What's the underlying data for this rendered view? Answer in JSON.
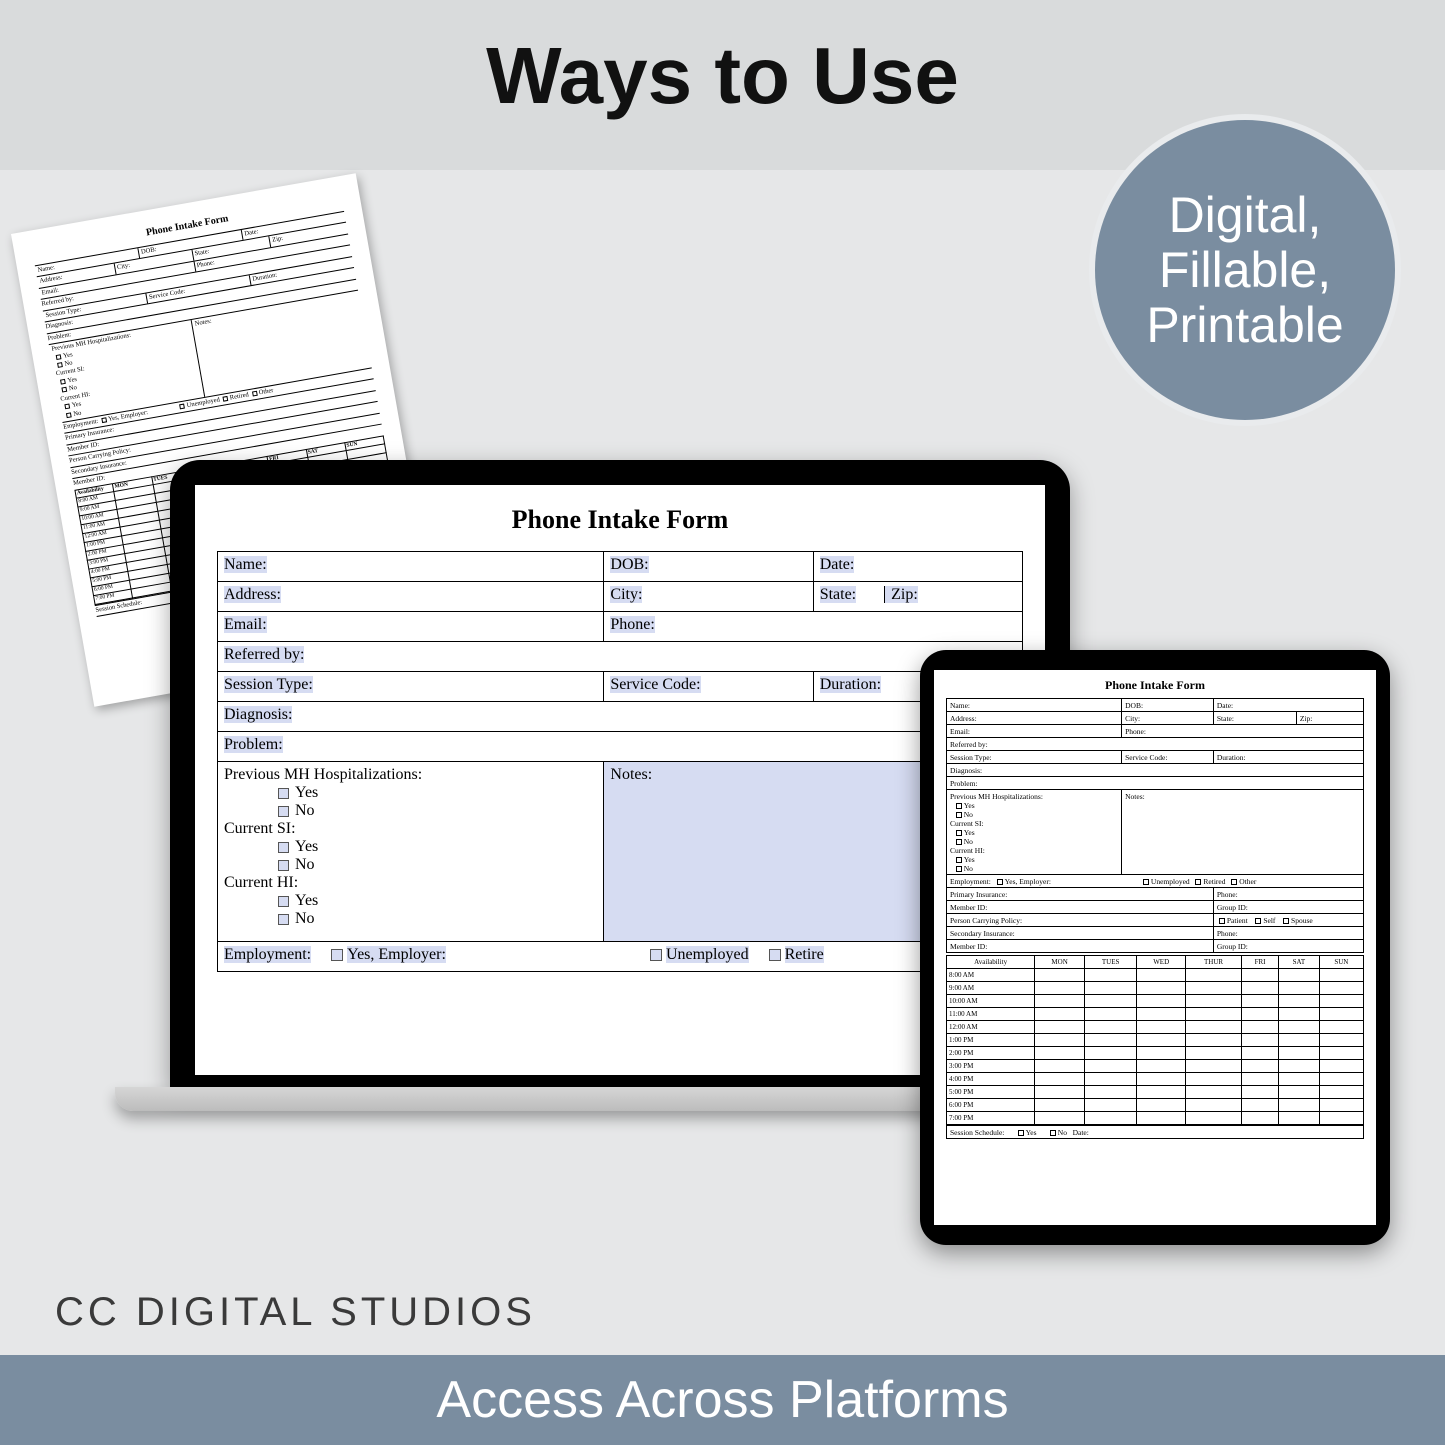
{
  "header": {
    "title": "Ways to Use"
  },
  "badge": {
    "line1": "Digital,",
    "line2": "Fillable,",
    "line3": "Printable"
  },
  "brand": "CC DIGITAL STUDIOS",
  "footer": "Access Across Platforms",
  "form": {
    "title": "Phone Intake Form",
    "name": "Name:",
    "dob": "DOB:",
    "date": "Date:",
    "address": "Address:",
    "city": "City:",
    "state": "State:",
    "zip": "Zip:",
    "email": "Email:",
    "phone": "Phone:",
    "referred": "Referred by:",
    "session": "Session Type:",
    "service": "Service Code:",
    "duration": "Duration:",
    "diagnosis": "Diagnosis:",
    "problem": "Problem:",
    "prevmh": "Previous MH Hospitalizations:",
    "yes": "Yes",
    "no": "No",
    "si": "Current SI:",
    "hi": "Current HI:",
    "notes": "Notes:",
    "employment": "Employment:",
    "yes_emp": "Yes, Employer:",
    "unemployed": "Unemployed",
    "retired": "Retired",
    "other": "Other",
    "primary_ins": "Primary Insurance:",
    "member": "Member ID:",
    "group": "Group ID:",
    "carrying": "Person Carrying Policy:",
    "patient": "Patient",
    "self": "Self",
    "spouse": "Spouse",
    "secondary": "Secondary Insurance:",
    "availability": "Availability",
    "days": [
      "MON",
      "TUES",
      "WED",
      "THUR",
      "FRI",
      "SAT",
      "SUN"
    ],
    "times": [
      "8:00 AM",
      "9:00 AM",
      "10:00 AM",
      "11:00 AM",
      "12:00 AM",
      "1:00 PM",
      "2:00 PM",
      "3:00 PM",
      "4:00 PM",
      "5:00 PM",
      "6:00 PM",
      "7:00 PM"
    ],
    "sess_sched": "Session Schedule:",
    "date_lbl": "Date:"
  }
}
